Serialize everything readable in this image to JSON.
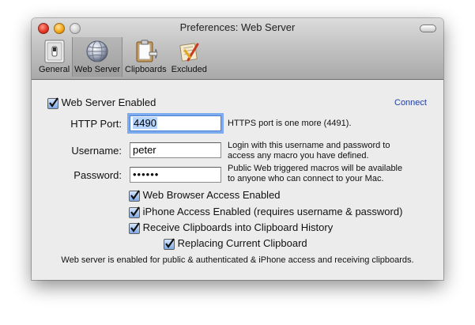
{
  "window": {
    "title": "Preferences: Web Server"
  },
  "toolbar": {
    "items": [
      {
        "label": "General",
        "icon": "switch-icon"
      },
      {
        "label": "Web Server",
        "icon": "globe-icon"
      },
      {
        "label": "Clipboards",
        "icon": "clipboard-icon"
      },
      {
        "label": "Excluded",
        "icon": "excluded-apps-icon"
      }
    ],
    "selected": "Web Server"
  },
  "webserver": {
    "enabled_label": "Web Server Enabled",
    "enabled": true,
    "connect_link": "Connect",
    "http_port_label": "HTTP Port:",
    "http_port_value": "4490",
    "https_hint": "HTTPS port is one more (4491).",
    "username_label": "Username:",
    "username_value": "peter",
    "login_hint_line1": "Login with this username and password to",
    "login_hint_line2": "access any macro you have defined.",
    "password_label": "Password:",
    "password_value": "••••••",
    "public_hint_line1": "Public Web triggered macros will be available",
    "public_hint_line2": "to anyone who can connect to your Mac.",
    "options": [
      {
        "label": "Web Browser Access Enabled",
        "checked": true
      },
      {
        "label": "iPhone Access Enabled (requires username & password)",
        "checked": true
      },
      {
        "label": "Receive Clipboards into Clipboard History",
        "checked": true
      },
      {
        "label": "Replacing Current Clipboard",
        "checked": true
      }
    ],
    "status": "Web server is enabled for public & authenticated & iPhone access and receiving clipboards."
  },
  "colors": {
    "link": "#1f3ea6",
    "focus_ring": "#7eaaf0",
    "checkbox": "#7ea9e6"
  }
}
